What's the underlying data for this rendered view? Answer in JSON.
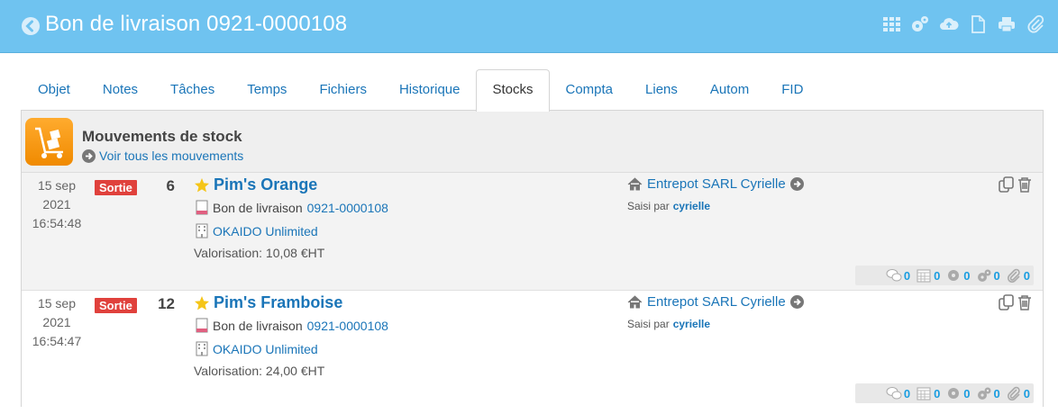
{
  "header": {
    "title": "Bon de livraison 0921-0000108"
  },
  "tabs": [
    {
      "label": "Objet"
    },
    {
      "label": "Notes"
    },
    {
      "label": "Tâches"
    },
    {
      "label": "Temps"
    },
    {
      "label": "Fichiers"
    },
    {
      "label": "Historique"
    },
    {
      "label": "Stocks"
    },
    {
      "label": "Compta"
    },
    {
      "label": "Liens"
    },
    {
      "label": "Autom"
    },
    {
      "label": "FID"
    }
  ],
  "panel": {
    "title": "Mouvements de stock",
    "see_all": "Voir tous les mouvements"
  },
  "movements": [
    {
      "date_day": "15 sep",
      "date_year": "2021",
      "time": "16:54:48",
      "badge": "Sortie",
      "qty": "6",
      "product": "Pim's Orange",
      "doc_label": "Bon de livraison",
      "doc_ref": "0921-0000108",
      "company": "OKAIDO Unlimited",
      "valuation_label": "Valorisation:",
      "valuation": "10,08 €HT",
      "warehouse": "Entrepot SARL Cyrielle",
      "entered_by_label": "Saisi par",
      "entered_by": "cyrielle",
      "counts": {
        "comments": "0",
        "calendar": "0",
        "tasks": "0",
        "automations": "0",
        "files": "0"
      }
    },
    {
      "date_day": "15 sep",
      "date_year": "2021",
      "time": "16:54:47",
      "badge": "Sortie",
      "qty": "12",
      "product": "Pim's Framboise",
      "doc_label": "Bon de livraison",
      "doc_ref": "0921-0000108",
      "company": "OKAIDO Unlimited",
      "valuation_label": "Valorisation:",
      "valuation": "24,00 €HT",
      "warehouse": "Entrepot SARL Cyrielle",
      "entered_by_label": "Saisi par",
      "entered_by": "cyrielle",
      "counts": {
        "comments": "0",
        "calendar": "0",
        "tasks": "0",
        "automations": "0",
        "files": "0"
      }
    }
  ],
  "colors": {
    "header_bg": "#6fc3f0",
    "link": "#1a75b8",
    "badge": "#e0413c",
    "count": "#1a9de0"
  }
}
